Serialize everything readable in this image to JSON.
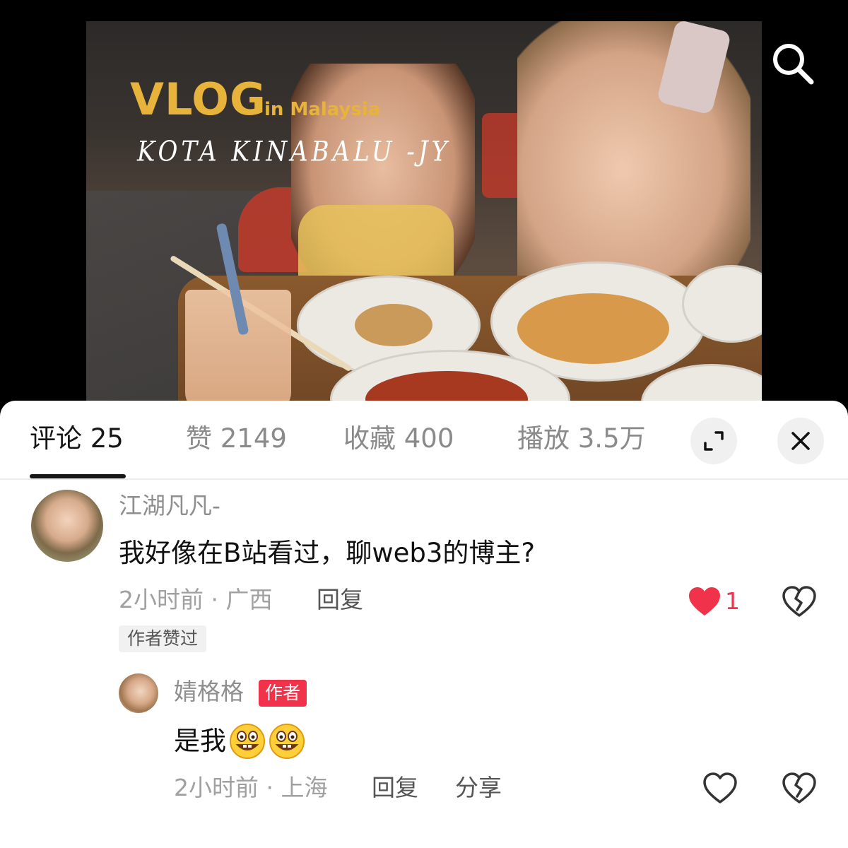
{
  "video": {
    "title": "VLOG",
    "subtitle": "in Malaysia",
    "location_caption": "KOTA KINABALU -JY",
    "search_icon": "search-icon"
  },
  "tabs": [
    {
      "label": "评论 25",
      "active": true
    },
    {
      "label": "赞 2149",
      "active": false
    },
    {
      "label": "收藏 400",
      "active": false
    },
    {
      "label": "播放 3.5万",
      "active": false
    }
  ],
  "panel_controls": {
    "expand_icon": "expand-icon",
    "close_icon": "close-icon"
  },
  "comments": [
    {
      "username": "江湖凡凡-",
      "text": "我好像在B站看过，聊web3的博主?",
      "meta": "2小时前 · 广西",
      "reply_label": "回复",
      "like_count": "1",
      "liked": true,
      "author_liked_badge": "作者赞过",
      "replies": [
        {
          "username": "婧格格",
          "author_tag": "作者",
          "text": "是我",
          "emojis": [
            "grinning-face-emoji",
            "grinning-face-emoji"
          ],
          "meta": "2小时前 · 上海",
          "reply_label": "回复",
          "share_label": "分享"
        }
      ]
    }
  ],
  "colors": {
    "accent_red": "#f0334a",
    "vlog_gold": "#e8b33a",
    "text_primary": "#111111",
    "text_secondary": "#8e8e8e"
  }
}
